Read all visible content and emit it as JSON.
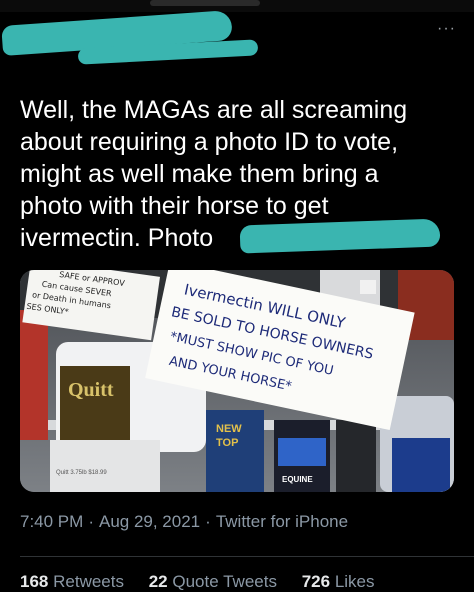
{
  "tweet": {
    "text": "Well, the MAGAs are all screaming\nabout requiring a photo ID to vote,\nmight as well make them bring a\nphoto with their horse to get\nivermectin. Photo",
    "time": "7:40 PM",
    "date": "Aug 29, 2021",
    "separator": "·",
    "client": "Twitter for iPhone",
    "more_icon": "···"
  },
  "photo": {
    "sign_lines": [
      "Ivermectin WILL ONLY",
      "BE SOLD TO HORSE OWNERS",
      "*MUST SHOW PIC OF YOU",
      "AND YOUR HORSE*"
    ],
    "warning_lines": [
      "SAFE or APPROV",
      "Can cause SEVER",
      "or Death in humans",
      "SES ONLY*"
    ],
    "bucket_brand": "Quitt",
    "bottle_labels": [
      "NEW",
      "TOP",
      "EQUINE"
    ],
    "price_tag": "Quitt 3.75lb $18.99"
  },
  "stats": {
    "retweets_count": "168",
    "retweets_label": "Retweets",
    "quotes_count": "22",
    "quotes_label": "Quote Tweets",
    "likes_count": "726",
    "likes_label": "Likes"
  },
  "colors": {
    "background": "#000000",
    "redaction": "#3ab5b0",
    "muted_text": "#8b98a5"
  }
}
